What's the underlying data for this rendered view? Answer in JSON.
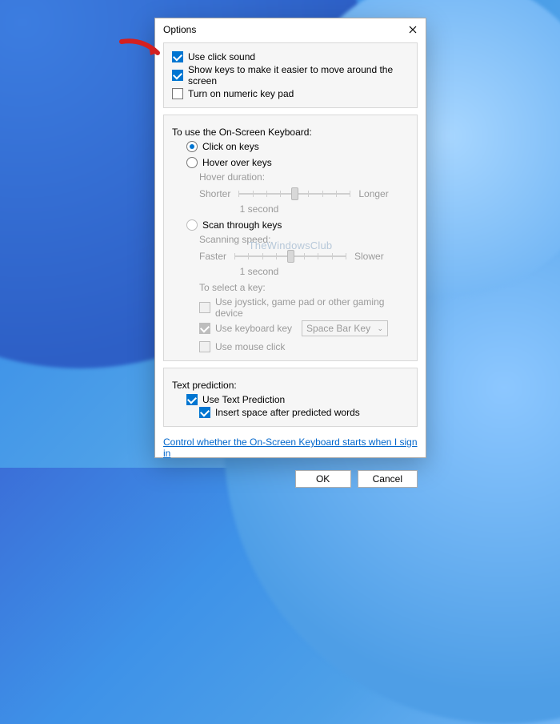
{
  "dialog": {
    "title": "Options",
    "sections": {
      "top": {
        "use_click_sound": "Use click sound",
        "show_keys": "Show keys to make it easier to move around the screen",
        "numeric_keypad": "Turn on numeric key pad"
      },
      "mode": {
        "heading": "To use the On-Screen Keyboard:",
        "click_on_keys": "Click on keys",
        "hover_over_keys": "Hover over keys",
        "hover_duration_label": "Hover duration:",
        "shorter": "Shorter",
        "longer": "Longer",
        "one_second_1": "1 second",
        "scan_through_keys": "Scan through keys",
        "scanning_speed_label": "Scanning speed:",
        "faster": "Faster",
        "slower": "Slower",
        "one_second_2": "1 second",
        "select_key_label": "To select a key:",
        "use_joystick": "Use joystick, game pad or other gaming device",
        "use_keyboard_key": "Use keyboard key",
        "space_bar_key": "Space Bar Key",
        "use_mouse_click": "Use mouse click"
      },
      "prediction": {
        "heading": "Text prediction:",
        "use_text_prediction": "Use Text Prediction",
        "insert_space": "Insert space after predicted words"
      }
    },
    "link": "Control whether the On-Screen Keyboard starts when I sign in",
    "buttons": {
      "ok": "OK",
      "cancel": "Cancel"
    }
  },
  "watermark": "TheWindowsClub"
}
